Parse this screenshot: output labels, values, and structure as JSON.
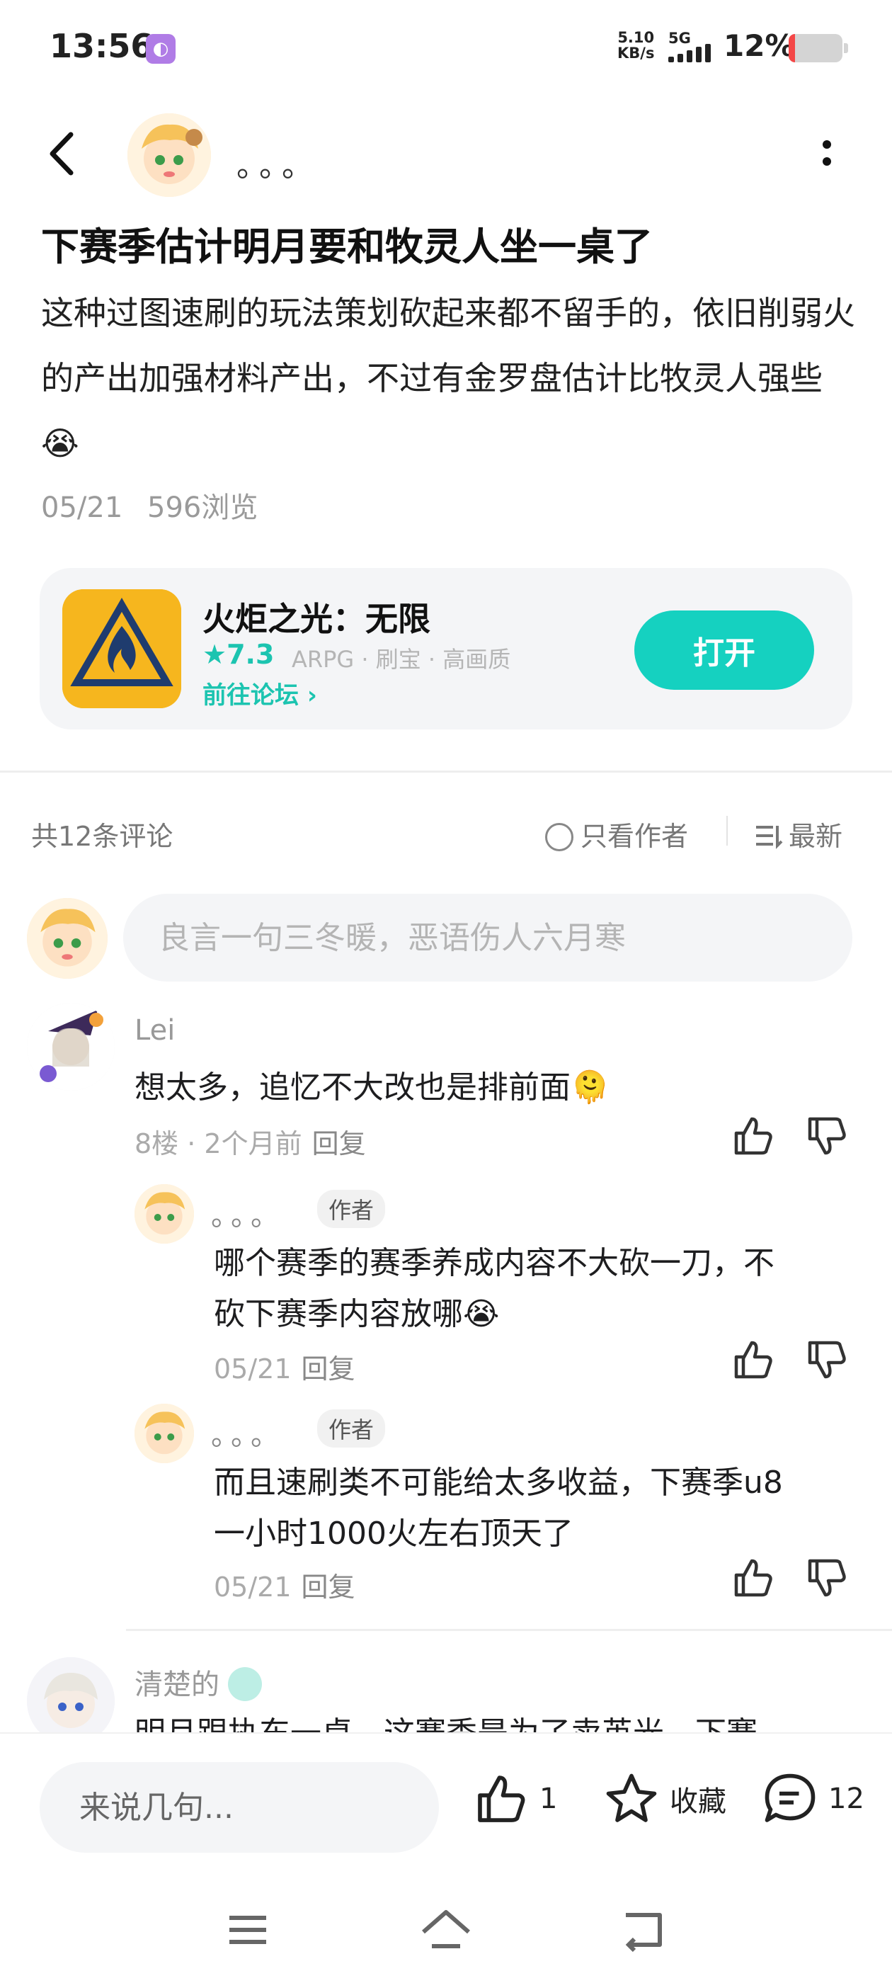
{
  "status_bar": {
    "time": "13:56",
    "net_speed_value": "5.10",
    "net_speed_unit": "KB/s",
    "network": "5G",
    "battery": "12%",
    "battery_level": 0.12
  },
  "header": {
    "author_name": "。。。"
  },
  "post": {
    "title": "下赛季估计明月要和牧灵人坐一桌了",
    "body": "这种过图速刷的玩法策划砍起来都不留手的，依旧削弱火的产出加强材料产出，不过有金罗盘估计比牧灵人强些😭",
    "date": "05/21",
    "views": "596浏览"
  },
  "game_card": {
    "name": "火炬之光：无限",
    "score": "★7.3",
    "tags": "ARPG · 刷宝 · 高画质",
    "forum_link": "前往论坛 ›",
    "open_button": "打开"
  },
  "comments_bar": {
    "count": "共12条评论",
    "author_only": "只看作者",
    "sort": "最新"
  },
  "comment_input": {
    "placeholder": "良言一句三冬暖，恶语伤人六月寒"
  },
  "comments": [
    {
      "name": "Lei",
      "text": "想太多，追忆不大改也是排前面🫠",
      "meta": "8楼 · 2个月前",
      "reply": "回复",
      "replies": [
        {
          "name": "。。。",
          "tag": "作者",
          "text_line1": "哪个赛季的赛季养成内容不大砍一刀，不",
          "text_line2": "砍下赛季内容放哪😭",
          "meta": "05/21",
          "reply": "回复"
        },
        {
          "name": "。。。",
          "tag": "作者",
          "text_line1": "而且速刷类不可能给太多收益，下赛季u8",
          "text_line2": "一小时1000火左右顶天了",
          "meta": "05/21",
          "reply": "回复"
        }
      ]
    },
    {
      "name": "清楚的",
      "text": "明月跟执东一桌，这赛季是为了卖英光，下赛"
    }
  ],
  "bottom_bar": {
    "input_placeholder": "来说几句...",
    "like_count": "1",
    "favorite_label": "收藏",
    "comment_count": "12"
  },
  "colors": {
    "accent": "#15d1c0",
    "game_icon_bg": "#f6b61e",
    "battery_low": "#f44747"
  }
}
